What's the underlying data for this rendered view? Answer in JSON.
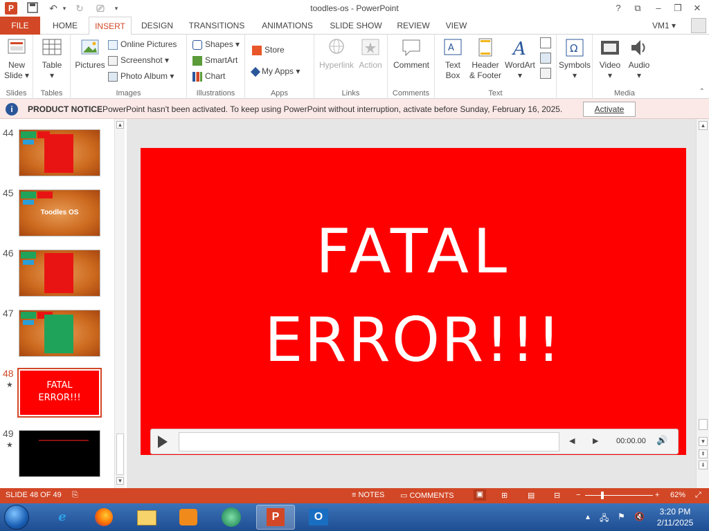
{
  "titlebar": {
    "title": "toodles-os - PowerPoint",
    "help": "?",
    "logo_letter": "P"
  },
  "tabs": {
    "file": "FILE",
    "home": "HOME",
    "insert": "INSERT",
    "design": "DESIGN",
    "transitions": "TRANSITIONS",
    "animations": "ANIMATIONS",
    "slideshow": "SLIDE SHOW",
    "review": "REVIEW",
    "view": "VIEW",
    "user": "VM1"
  },
  "ribbon": {
    "slides": {
      "new_slide_1": "New",
      "new_slide_2": "Slide",
      "group": "Slides"
    },
    "tables": {
      "table": "Table",
      "group": "Tables"
    },
    "images": {
      "pictures": "Pictures",
      "online_pictures": "Online Pictures",
      "screenshot": "Screenshot",
      "photo_album": "Photo Album",
      "group": "Images"
    },
    "illustrations": {
      "shapes": "Shapes",
      "smartart": "SmartArt",
      "chart": "Chart",
      "group": "Illustrations"
    },
    "apps": {
      "store": "Store",
      "my_apps": "My Apps",
      "group": "Apps"
    },
    "links": {
      "hyperlink": "Hyperlink",
      "action": "Action",
      "group": "Links"
    },
    "comments": {
      "comment": "Comment",
      "group": "Comments"
    },
    "text": {
      "textbox_1": "Text",
      "textbox_2": "Box",
      "header_1": "Header",
      "header_2": "& Footer",
      "wordart": "WordArt",
      "group": "Text"
    },
    "symbols": {
      "symbols": "Symbols"
    },
    "media": {
      "video": "Video",
      "audio": "Audio",
      "group": "Media"
    }
  },
  "notice": {
    "icon": "i",
    "heading": "PRODUCT NOTICE",
    "message": "PowerPoint hasn't been activated. To keep using PowerPoint without interruption, activate before Sunday, February 16, 2025.",
    "button": "Activate"
  },
  "thumbnails": {
    "n44": "44",
    "n45": "45",
    "n46": "46",
    "n47": "47",
    "n48": "48",
    "n49": "49",
    "star": "★",
    "t45_text": "Toodles OS",
    "t48_line1": "FATAL",
    "t48_line2": "ERROR!!!"
  },
  "slide": {
    "line1": "FATAL",
    "line2": "ERROR!!!",
    "background": "#ff0000"
  },
  "player": {
    "time": "00:00.00"
  },
  "status": {
    "slide_info": "SLIDE 48 OF 49",
    "notes": "NOTES",
    "comments": "COMMENTS",
    "zoom": "62%",
    "minus": "−",
    "plus": "+"
  },
  "taskbar": {
    "time": "3:20 PM",
    "date": "2/11/2025"
  },
  "colors": {
    "accent": "#d24726",
    "notice_bg": "#fbe9e7"
  }
}
